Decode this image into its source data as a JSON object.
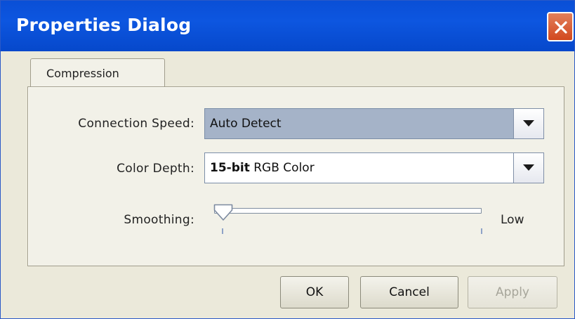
{
  "window": {
    "title": "Properties Dialog"
  },
  "tabs": [
    {
      "label": "Compression",
      "active": true
    }
  ],
  "fields": {
    "connection_speed": {
      "label": "Connection Speed:",
      "value": "Auto Detect"
    },
    "color_depth": {
      "label": "Color Depth:",
      "value_bold": "15-bit",
      "value_rest": " RGB Color"
    },
    "smoothing": {
      "label": "Smoothing:",
      "end_label": "Low",
      "level": 0
    }
  },
  "buttons": {
    "ok": "OK",
    "cancel": "Cancel",
    "apply": "Apply"
  },
  "icons": {
    "close": "close-icon",
    "dropdown": "chevron-down-icon"
  },
  "colors": {
    "titlebar": "#0a4fd6",
    "close_button": "#d9562d",
    "combo_selected": "#a5b3c8"
  }
}
